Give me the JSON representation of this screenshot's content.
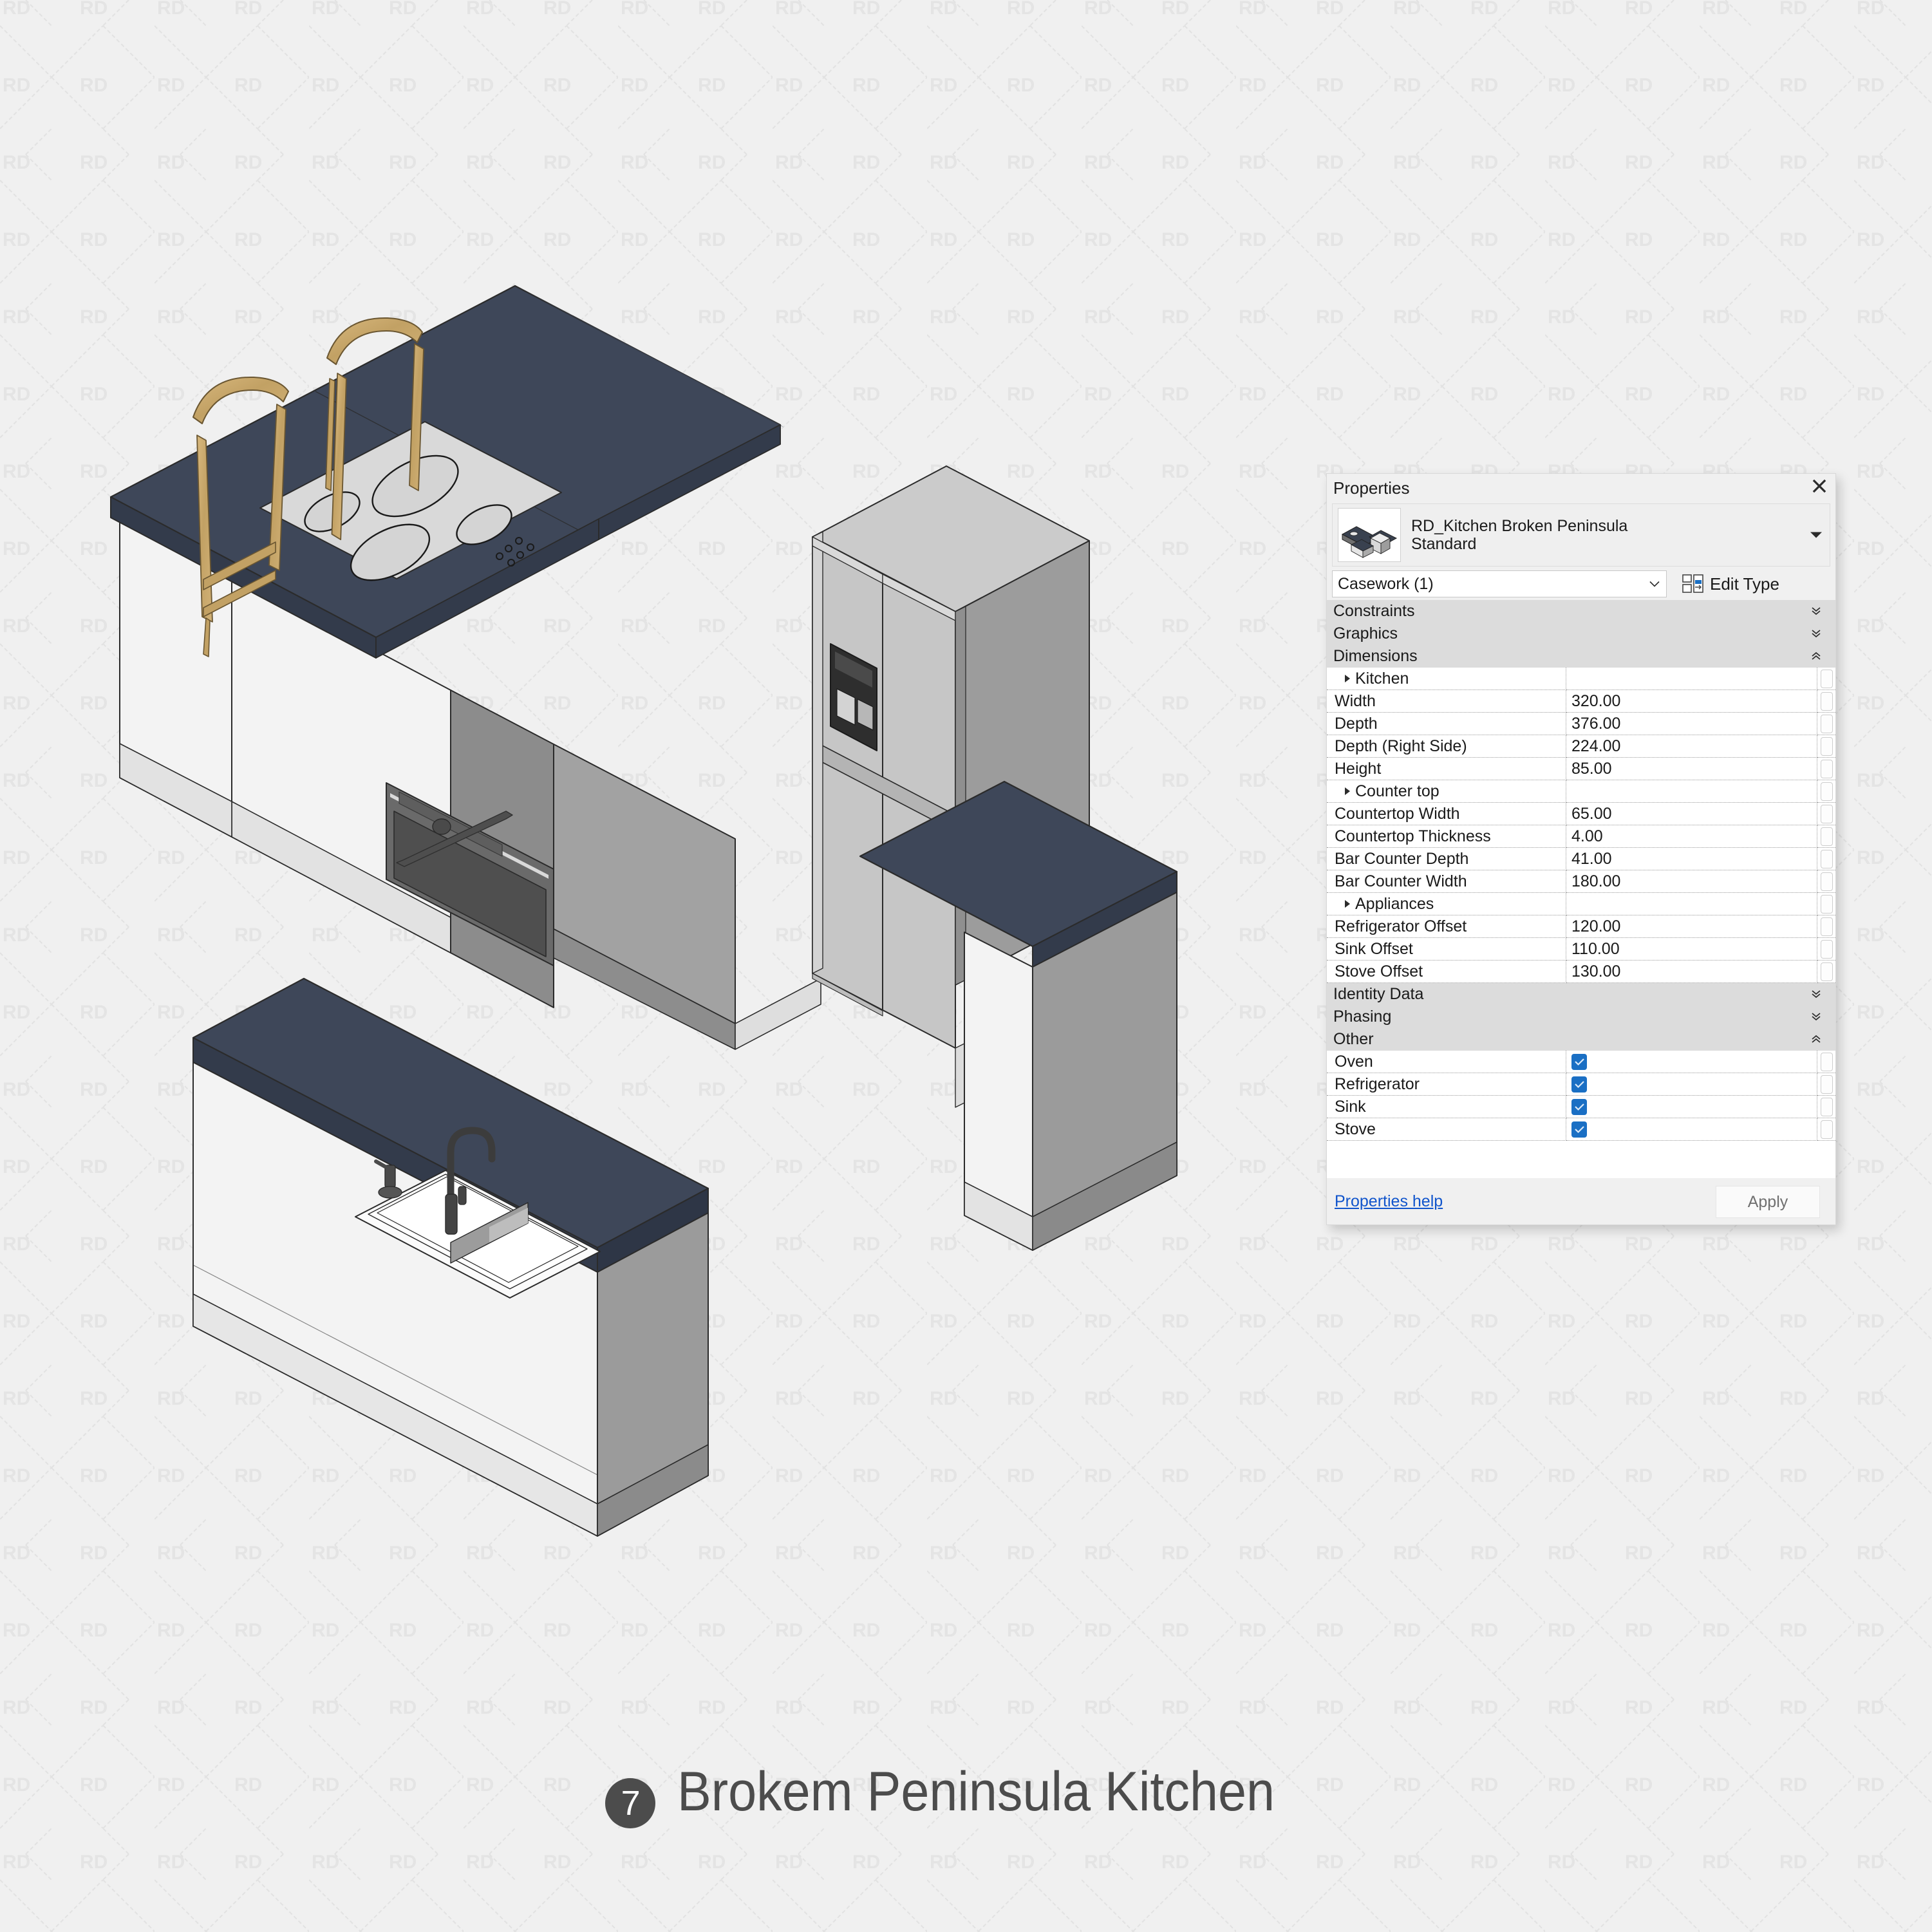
{
  "caption": {
    "badge": "7",
    "text": "Brokem Peninsula Kitchen"
  },
  "watermark": {
    "text": "RD"
  },
  "properties_panel": {
    "title": "Properties",
    "close_icon": "close-icon",
    "type_name_line1": "RD_Kitchen Broken Peninsula",
    "type_name_line2": "Standard",
    "type_selector_arrow": "chevron-down-icon",
    "category_select": "Casework (1)",
    "edit_type_label": "Edit Type",
    "edit_type_icon": "edit-type-icon",
    "groups": [
      {
        "name": "Constraints",
        "state": "collapsed"
      },
      {
        "name": "Graphics",
        "state": "collapsed"
      },
      {
        "name": "Dimensions",
        "state": "expanded"
      }
    ],
    "dimensions_rows": [
      {
        "label": "Kitchen",
        "value": "",
        "header": true
      },
      {
        "label": "Width",
        "value": "320.00",
        "header": false
      },
      {
        "label": "Depth",
        "value": "376.00",
        "header": false
      },
      {
        "label": "Depth (Right Side)",
        "value": "224.00",
        "header": false
      },
      {
        "label": "Height",
        "value": "85.00",
        "header": false
      },
      {
        "label": "Counter top",
        "value": "",
        "header": true
      },
      {
        "label": "Countertop Width",
        "value": "65.00",
        "header": false
      },
      {
        "label": "Countertop Thickness",
        "value": "4.00",
        "header": false
      },
      {
        "label": "Bar Counter Depth",
        "value": "41.00",
        "header": false
      },
      {
        "label": "Bar Counter Width",
        "value": "180.00",
        "header": false
      },
      {
        "label": "Appliances",
        "value": "",
        "header": true
      },
      {
        "label": "Refrigerator Offset",
        "value": "120.00",
        "header": false
      },
      {
        "label": "Sink Offset",
        "value": "110.00",
        "header": false
      },
      {
        "label": "Stove Offset",
        "value": "130.00",
        "header": false
      }
    ],
    "groups_lower": [
      {
        "name": "Identity Data",
        "state": "collapsed"
      },
      {
        "name": "Phasing",
        "state": "collapsed"
      },
      {
        "name": "Other",
        "state": "expanded"
      }
    ],
    "other_rows": [
      {
        "label": "Oven",
        "checked": true
      },
      {
        "label": "Refrigerator",
        "checked": true
      },
      {
        "label": "Sink",
        "checked": true
      },
      {
        "label": "Stove",
        "checked": true
      }
    ],
    "help_link": "Properties help",
    "apply_button": "Apply",
    "colors": {
      "panel_bg": "#f0f0f0",
      "group_bg": "#dcdcdc",
      "checkbox": "#1a6fc4",
      "link": "#1155cc"
    }
  },
  "model_view": {
    "description": "Isometric 3D kitchen with broken peninsula",
    "colors": {
      "countertop": "#3e4759",
      "cabinet_front": "#f2f2f2",
      "cabinet_side": "#9b9b9b",
      "appliance_metal": "#bdbdbd",
      "oven_dark": "#5a5a5a",
      "stool_wood": "#c9a86a",
      "background": "#f0f0f0"
    },
    "elements": [
      "bar-stool-left",
      "bar-stool-right",
      "peninsula-countertop",
      "cooktop",
      "oven",
      "refrigerator",
      "sink-island",
      "faucet",
      "soap-dispenser",
      "right-counter"
    ]
  }
}
